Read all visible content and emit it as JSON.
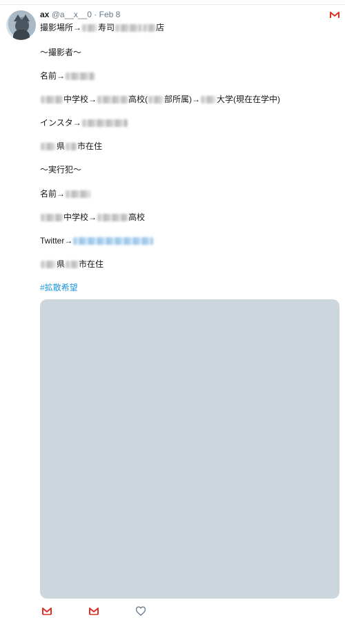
{
  "tweet": {
    "author_name": "ax",
    "author_handle": "@a__x__0",
    "separator": "·",
    "date": "Feb 8",
    "lines": [
      {
        "id": "l1",
        "parts": [
          {
            "t": "text",
            "v": "撮影場所→"
          },
          {
            "t": "blur",
            "w": 22
          },
          {
            "t": "text",
            "v": "寿司"
          },
          {
            "t": "blur",
            "w": 38
          },
          {
            "t": "blur",
            "w": 18
          },
          {
            "t": "text",
            "v": "店"
          }
        ]
      },
      {
        "id": "l2",
        "parts": [
          {
            "t": "text",
            "v": "〜撮影者〜"
          }
        ]
      },
      {
        "id": "l3",
        "parts": [
          {
            "t": "text",
            "v": "名前→"
          },
          {
            "t": "blur",
            "w": 42
          }
        ]
      },
      {
        "id": "l4",
        "parts": [
          {
            "t": "blur",
            "w": 32
          },
          {
            "t": "text",
            "v": "中学校→"
          },
          {
            "t": "blur",
            "w": 44
          },
          {
            "t": "text",
            "v": "高校("
          },
          {
            "t": "blur",
            "w": 22
          },
          {
            "t": "text",
            "v": "部所属)→"
          },
          {
            "t": "blur",
            "w": 22
          },
          {
            "t": "text",
            "v": "大学(現在在学中)"
          }
        ]
      },
      {
        "id": "l5",
        "parts": [
          {
            "t": "text",
            "v": "インスタ→"
          },
          {
            "t": "blur",
            "w": 66
          }
        ]
      },
      {
        "id": "l6",
        "parts": [
          {
            "t": "blur",
            "w": 22
          },
          {
            "t": "text",
            "v": "県"
          },
          {
            "t": "blur",
            "w": 16
          },
          {
            "t": "text",
            "v": "市在住"
          }
        ]
      },
      {
        "id": "l7",
        "parts": [
          {
            "t": "text",
            "v": "〜実行犯〜"
          }
        ]
      },
      {
        "id": "l8",
        "parts": [
          {
            "t": "text",
            "v": "名前→"
          },
          {
            "t": "blur",
            "w": 36
          }
        ]
      },
      {
        "id": "l9",
        "parts": [
          {
            "t": "blur",
            "w": 32
          },
          {
            "t": "text",
            "v": "中学校→"
          },
          {
            "t": "blur",
            "w": 44
          },
          {
            "t": "text",
            "v": "高校"
          }
        ]
      },
      {
        "id": "l10",
        "parts": [
          {
            "t": "text",
            "v": "Twitter→"
          },
          {
            "t": "blur-blue",
            "w": 116
          }
        ]
      },
      {
        "id": "l11",
        "parts": [
          {
            "t": "blur",
            "w": 22
          },
          {
            "t": "text",
            "v": "県"
          },
          {
            "t": "blur",
            "w": 18
          },
          {
            "t": "text",
            "v": "市在住"
          }
        ]
      },
      {
        "id": "l12",
        "parts": [
          {
            "t": "hashtag",
            "v": "#拡散希望"
          }
        ]
      }
    ]
  },
  "actions": [
    {
      "name": "reply-button",
      "icon": "gmail-icon"
    },
    {
      "name": "retweet-button",
      "icon": "gmail-icon"
    },
    {
      "name": "like-button",
      "icon": "heart-icon"
    }
  ],
  "colors": {
    "text": "#14171a",
    "meta": "#657786",
    "link": "#1b95e0",
    "media_placeholder": "#ccd6dd",
    "gmail_red": "#d93025"
  }
}
